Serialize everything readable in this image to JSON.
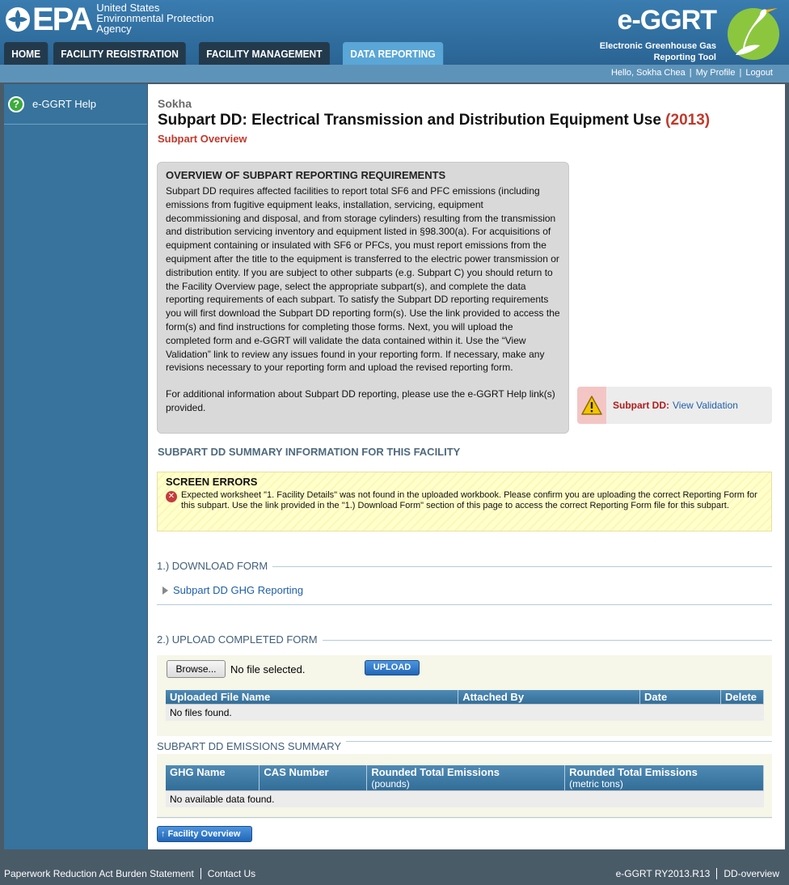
{
  "header": {
    "epa_word": "EPA",
    "agency_line1": "United States",
    "agency_line2": "Environmental Protection",
    "agency_line3": "Agency",
    "app_title": "e-GGRT",
    "app_sub1": "Electronic Greenhouse Gas",
    "app_sub2": "Reporting Tool"
  },
  "tabs": [
    "HOME",
    "FACILITY REGISTRATION",
    "FACILITY MANAGEMENT",
    "DATA REPORTING"
  ],
  "active_tab": "DATA REPORTING",
  "userbar": {
    "greeting": "Hello, Sokha Chea",
    "profile": "My Profile",
    "logout": "Logout"
  },
  "sidebar": {
    "help_label": "e-GGRT Help"
  },
  "page": {
    "facility": "Sokha",
    "title": "Subpart DD: Electrical Transmission and Distribution Equipment Use",
    "year": "(2013)",
    "overview_link": "Subpart Overview"
  },
  "overview": {
    "heading": "OVERVIEW OF SUBPART REPORTING REQUIREMENTS",
    "para1": "Subpart DD requires affected facilities to report total SF6 and PFC emissions (including emissions from fugitive equipment leaks, installation, servicing, equipment decommissioning and disposal, and from storage cylinders) resulting from the transmission and distribution servicing inventory and equipment listed in §98.300(a). For acquisitions of equipment containing or insulated with SF6 or PFCs, you must report emissions from the equipment after the title to the equipment is transferred to the electric power transmission or distribution entity. If you are subject to other subparts (e.g. Subpart C) you should return to the Facility Overview page, select the appropriate subpart(s), and complete the data reporting requirements of each subpart. To satisfy the Subpart DD reporting requirements you will first download the Subpart DD reporting form(s). Use the link provided to access the form(s) and find instructions for completing those forms. Next, you will upload the completed form and e-GGRT will validate the data contained within it. Use the “View Validation” link to review any issues found in your reporting form. If necessary, make any revisions necessary to your reporting form and upload the revised reporting form.",
    "para2": "For additional information about Subpart DD reporting, please use the e-GGRT Help link(s) provided."
  },
  "validation": {
    "label": "Subpart DD:",
    "link": "View Validation"
  },
  "summary_heading": "SUBPART DD SUMMARY INFORMATION FOR THIS FACILITY",
  "errors": {
    "heading": "SCREEN ERRORS",
    "message": "Expected worksheet \"1. Facility Details\" was not found in the uploaded workbook. Please confirm you are uploading the correct Reporting Form for this subpart. Use the link provided in the \"1.) Download Form\" section of this page to access the correct Reporting Form file for this subpart."
  },
  "download": {
    "heading": "1.) DOWNLOAD FORM",
    "link": "Subpart DD GHG Reporting"
  },
  "upload": {
    "heading": "2.) UPLOAD COMPLETED FORM",
    "browse": "Browse...",
    "no_file": "No file selected.",
    "upload_btn": "UPLOAD",
    "columns": [
      "Uploaded File Name",
      "Attached By",
      "Date",
      "Delete"
    ],
    "empty": "No files found."
  },
  "emissions": {
    "heading": "SUBPART DD EMISSIONS SUMMARY",
    "col1": "GHG Name",
    "col2": "CAS Number",
    "col3": "Rounded Total Emissions",
    "col3_sub": "(pounds)",
    "col4": "Rounded Total Emissions",
    "col4_sub": "(metric tons)",
    "empty": "No available data found."
  },
  "facility_overview_btn": "Facility Overview",
  "footer": {
    "paperwork": "Paperwork Reduction Act Burden Statement",
    "contact": "Contact Us",
    "version": "e-GGRT RY2013.R13",
    "page_id": "DD-overview"
  }
}
